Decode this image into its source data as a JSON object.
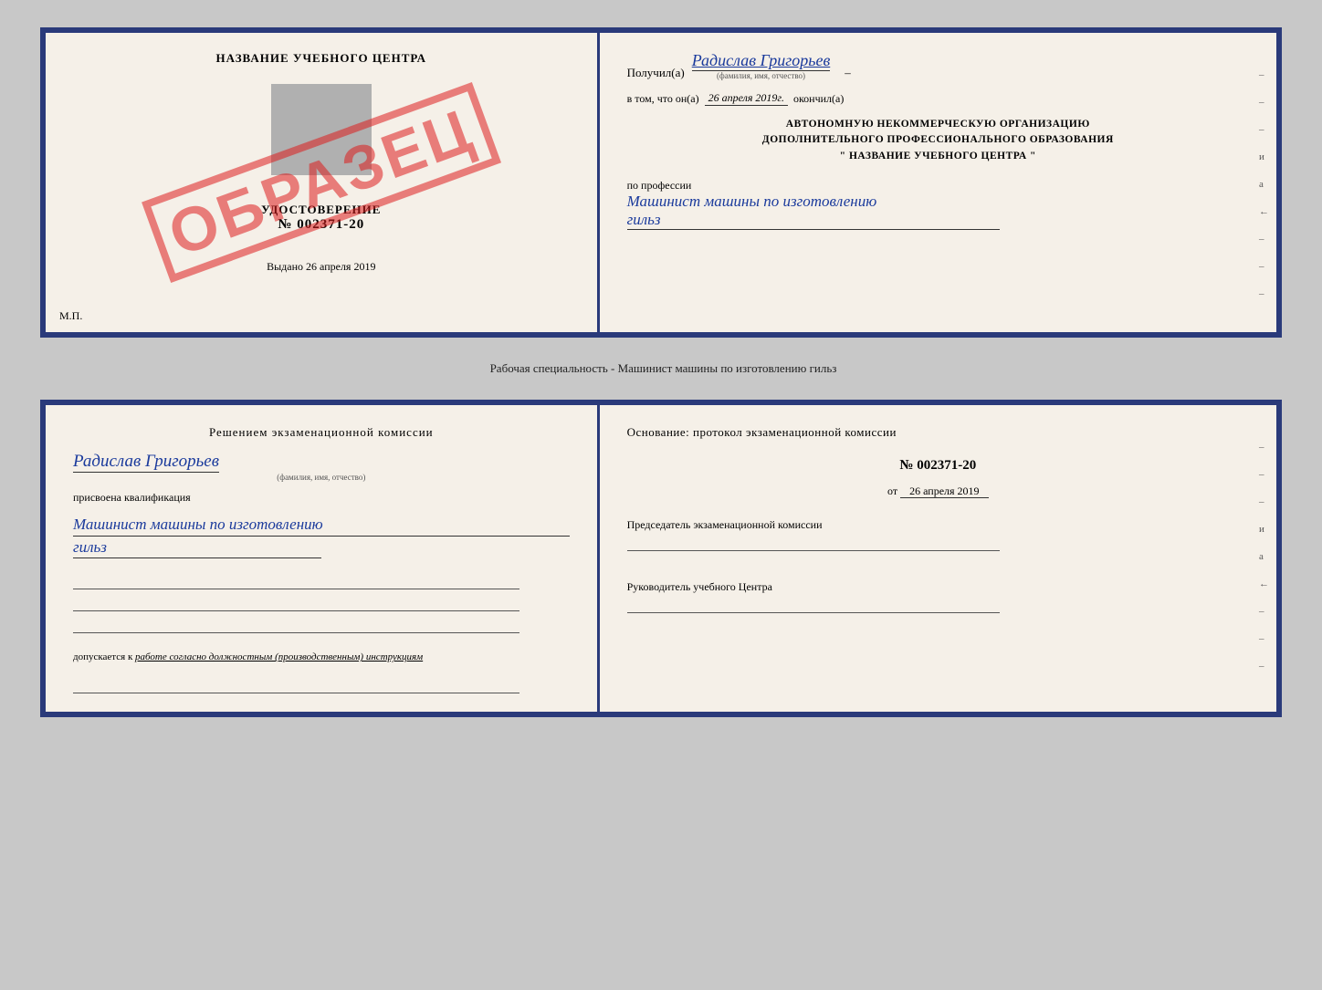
{
  "top_doc": {
    "left": {
      "school_name": "НАЗВАНИЕ УЧЕБНОГО ЦЕНТРА",
      "photo_alt": "photo",
      "udostoverenie_title": "УДОСТОВЕРЕНИЕ",
      "udostoverenie_num": "№ 002371-20",
      "vydano_label": "Выдано",
      "vydano_date": "26 апреля 2019",
      "mp_label": "М.П.",
      "stamp": "ОБРАЗЕЦ"
    },
    "right": {
      "poluchil_label": "Получил(а)",
      "person_name": "Радислав Григорьев",
      "fio_sub": "(фамилия, имя, отчество)",
      "vtom_label": "в том, что он(а)",
      "vtom_date": "26 апреля 2019г.",
      "okonchil_label": "окончил(а)",
      "org_line1": "АВТОНОМНУЮ НЕКОММЕРЧЕСКУЮ ОРГАНИЗАЦИЮ",
      "org_line2": "ДОПОЛНИТЕЛЬНОГО ПРОФЕССИОНАЛЬНОГО ОБРАЗОВАНИЯ",
      "org_quote_open": "\"",
      "org_school": "НАЗВАНИЕ УЧЕБНОГО ЦЕНТРА",
      "org_quote_close": "\"",
      "po_professii_label": "по профессии",
      "profession": "Машинист машины по изготовлению",
      "profession2": "гильз",
      "dashes": [
        "-",
        "-",
        "-",
        "и",
        "а",
        "←",
        "-",
        "-",
        "-"
      ]
    }
  },
  "separator": {
    "text": "Рабочая специальность - Машинист машины по изготовлению гильз"
  },
  "bottom_doc": {
    "left": {
      "komissia_text": "Решением  экзаменационной  комиссии",
      "person_name": "Радислав Григорьев",
      "fio_sub": "(фамилия, имя, отчество)",
      "prisvoena_label": "присвоена квалификация",
      "kvali_name": "Машинист машины по изготовлению",
      "kvali_name2": "гильз",
      "dopuskaetsya_label": "допускается к",
      "dopuskaetsya_text": "работе согласно должностным (производственным) инструкциям"
    },
    "right": {
      "osnov_label": "Основание: протокол экзаменационной  комиссии",
      "protocol_num": "№  002371-20",
      "protocol_date_prefix": "от",
      "protocol_date": "26 апреля 2019",
      "predsedatel_label": "Председатель экзаменационной комиссии",
      "rukovoditel_label": "Руководитель учебного Центра",
      "dashes": [
        "-",
        "-",
        "-",
        "и",
        "а",
        "←",
        "-",
        "-",
        "-"
      ]
    }
  }
}
